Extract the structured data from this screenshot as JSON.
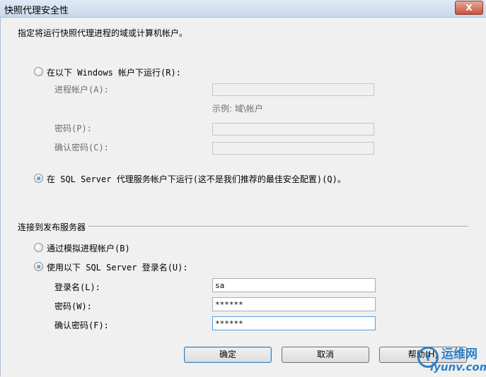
{
  "window": {
    "title": "快照代理安全性",
    "close_label": "X"
  },
  "header": {
    "instruction": "指定将运行快照代理进程的域或计算机帐户。"
  },
  "process_account": {
    "option_windows": {
      "label": "在以下 Windows 帐户下运行(R):",
      "selected": false
    },
    "account_label": "进程帐户(A):",
    "account_value": "",
    "example_hint": "示例: 域\\帐户",
    "password_label": "密码(P):",
    "password_value": "",
    "confirm_label": "确认密码(C):",
    "confirm_value": "",
    "option_sql_agent": {
      "label": "在 SQL Server 代理服务帐户下运行(这不是我们推荐的最佳安全配置)(Q)。",
      "selected": true
    }
  },
  "publisher_connection": {
    "group_label": "连接到发布服务器",
    "option_impersonate": {
      "label": "通过模拟进程帐户(B)",
      "selected": false
    },
    "option_sql_login": {
      "label": "使用以下 SQL Server 登录名(U):",
      "selected": true
    },
    "login_label": "登录名(L):",
    "login_value": "sa",
    "password_label": "密码(W):",
    "password_value": "******",
    "confirm_label": "确认密码(F):",
    "confirm_value": "******"
  },
  "buttons": {
    "ok": "确定",
    "cancel": "取消",
    "help": "帮助(H)"
  },
  "watermark": {
    "logo_letter": "i",
    "site_name": "运维网",
    "url": "iyunv.com"
  },
  "colors": {
    "accent": "#1b5fa8",
    "watermark": "#2f7fc8",
    "window_bg": "#f0f0f0"
  }
}
